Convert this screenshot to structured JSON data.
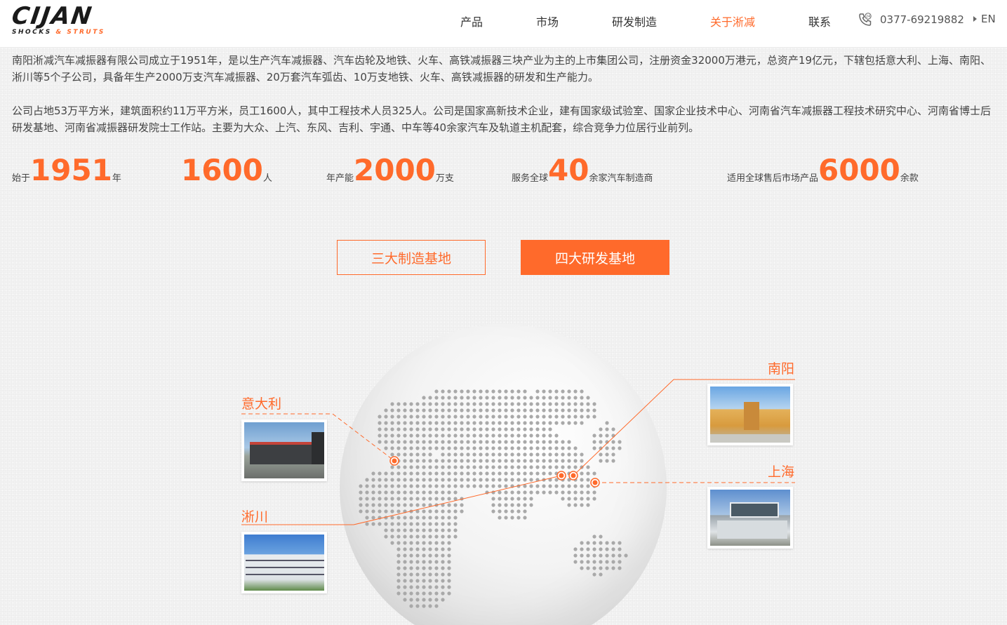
{
  "header": {
    "logo_main": "CIJAN",
    "logo_sub_1": "SHOCKS",
    "logo_sub_amp": "&",
    "logo_sub_2": "STRUTS",
    "nav": [
      "产品",
      "市场",
      "研发制造",
      "关于淅减",
      "联系"
    ],
    "active_nav": "关于淅减",
    "phone": "0377-69219882",
    "lang": "EN"
  },
  "intro": {
    "para1": "南阳淅减汽车减振器有限公司成立于1951年，是以生产汽车减振器、汽车齿轮及地铁、火车、高铁减振器三块产业为主的上市集团公司，注册资金32000万港元，总资产19亿元，下辖包括意大利、上海、南阳、淅川等5个子公司，具备年生产2000万支汽车减振器、20万套汽车弧齿、10万支地铁、火车、高铁减振器的研发和生产能力。",
    "para2": "公司占地53万平方米，建筑面积约11万平方米，员工1600人，其中工程技术人员325人。公司是国家高新技术企业，建有国家级试验室、国家企业技术中心、河南省汽车减振器工程技术研究中心、河南省博士后研发基地、河南省减振器研发院士工作站。主要为大众、上汽、东风、吉利、宇通、中车等40余家汽车及轨道主机配套，综合竞争力位居行业前列。"
  },
  "stats": [
    {
      "prefix": "始于",
      "value": "1951",
      "suffix": "年"
    },
    {
      "prefix": "",
      "value": "1600",
      "suffix": "人"
    },
    {
      "prefix": "年产能",
      "value": "2000",
      "suffix": "万支"
    },
    {
      "prefix": "服务全球",
      "value": "40",
      "suffix": "余家汽车制造商"
    },
    {
      "prefix": "适用全球售后市场产品",
      "value": "6000",
      "suffix": "余款"
    }
  ],
  "tabs": {
    "manufacturing": "三大制造基地",
    "rnd": "四大研发基地"
  },
  "bases": {
    "italy": "意大利",
    "xichuan": "淅川",
    "nanyang": "南阳",
    "shanghai": "上海"
  },
  "colors": {
    "accent": "#ff6a2b",
    "text": "#444444"
  }
}
